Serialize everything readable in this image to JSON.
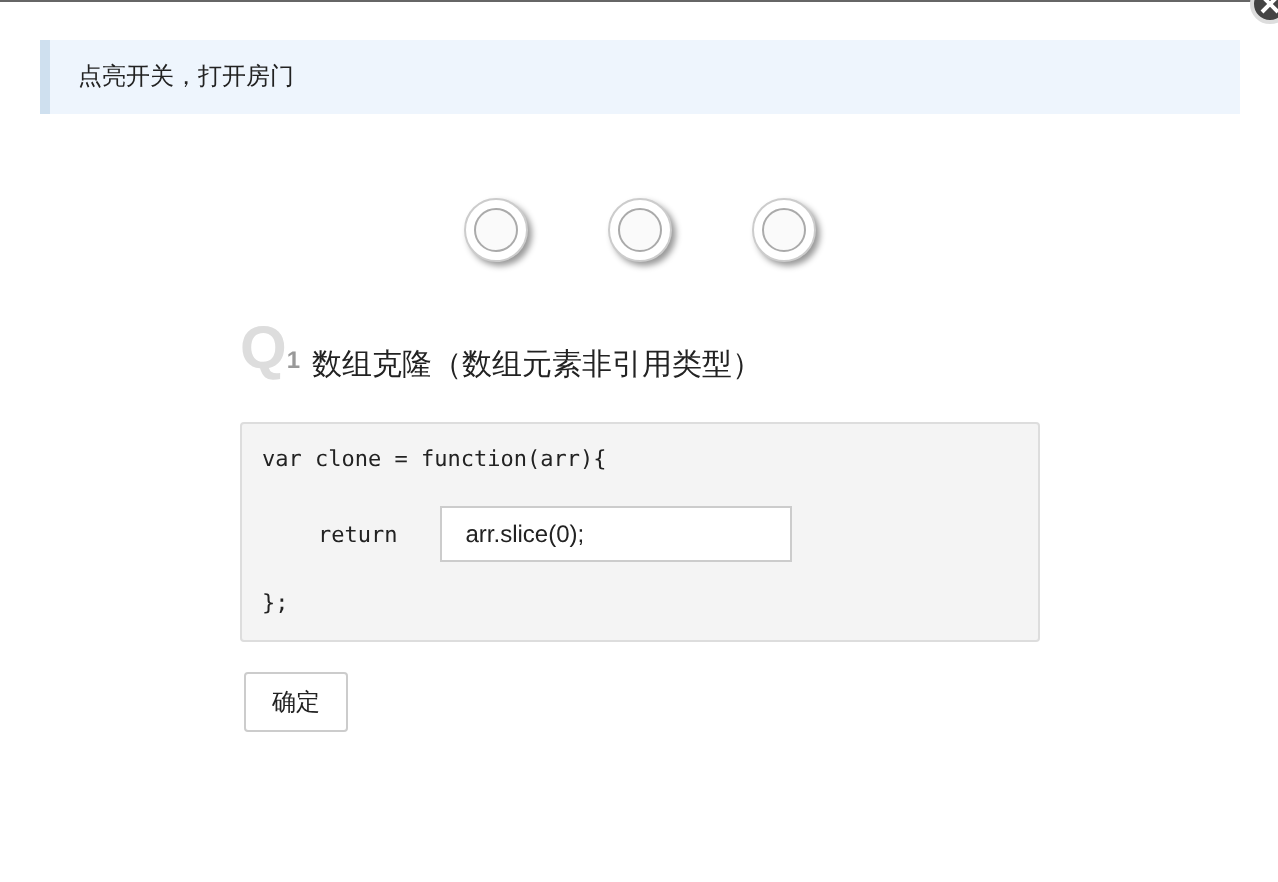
{
  "notice": "点亮开关，打开房门",
  "switches": [
    {
      "on": false
    },
    {
      "on": false
    },
    {
      "on": false
    }
  ],
  "question": {
    "number_letter": "Q",
    "number": "1",
    "title": "数组克隆（数组元素非引用类型）"
  },
  "code": {
    "line_1": "var clone = function(arr){",
    "keyword": "return",
    "answer": {
      "value": "arr.slice(0);"
    },
    "line_3": "};"
  },
  "buttons": [
    {
      "label": "确定"
    }
  ]
}
